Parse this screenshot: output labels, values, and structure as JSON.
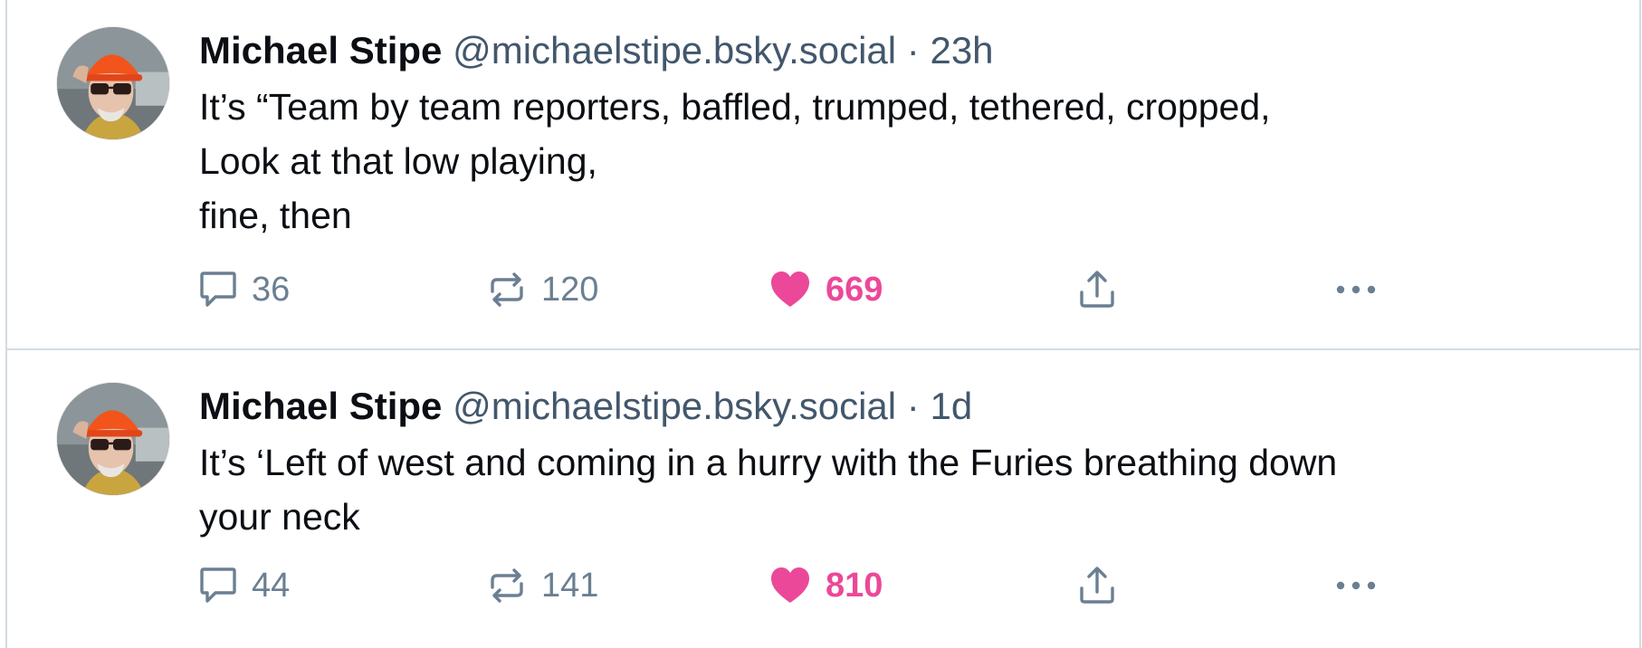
{
  "posts": [
    {
      "author": "Michael Stipe",
      "handle": "@michaelstipe.bsky.social",
      "separator": "·",
      "time": "23h",
      "text": "It’s “Team by team reporters, baffled, trumped, tethered, cropped,\nLook at that low playing,\nfine, then",
      "replies": "36",
      "reposts": "120",
      "likes": "669",
      "liked": true
    },
    {
      "author": "Michael Stipe",
      "handle": "@michaelstipe.bsky.social",
      "separator": "·",
      "time": "1d",
      "text": "It’s ‘Left of west and coming in a hurry with the Furies breathing down\nyour neck",
      "replies": "44",
      "reposts": "141",
      "likes": "810",
      "liked": true
    }
  ],
  "icons": {
    "reply": "speech-bubble-icon",
    "repost": "repost-arrows-icon",
    "like": "heart-icon",
    "share": "share-upload-icon",
    "more": "more-dots-icon"
  },
  "colors": {
    "like_active": "#ec4899",
    "muted": "#6b7f92",
    "handle": "#42576c",
    "divider": "#d4dbe2",
    "avatar_hat": "#f2541b"
  }
}
